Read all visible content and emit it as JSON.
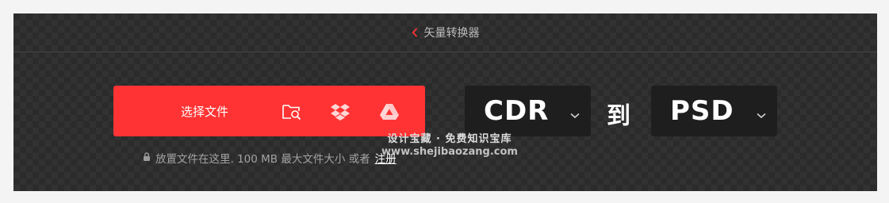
{
  "topbar": {
    "back_label": "矢量转换器"
  },
  "uploader": {
    "choose_file_label": "选择文件",
    "hint_text": "放置文件在这里. 100 MB 最大文件大小 或者",
    "signup_label": "注册"
  },
  "converter": {
    "from_format": "CDR",
    "to_label": "到",
    "to_format": "PSD"
  },
  "watermark": {
    "line1": "设计宝藏 · 免费知识宝库",
    "line2": "www.shejibaozang.com"
  },
  "colors": {
    "accent": "#ff3333",
    "panel_bg": "#2b2b2b",
    "select_bg": "#1e1e1e"
  }
}
